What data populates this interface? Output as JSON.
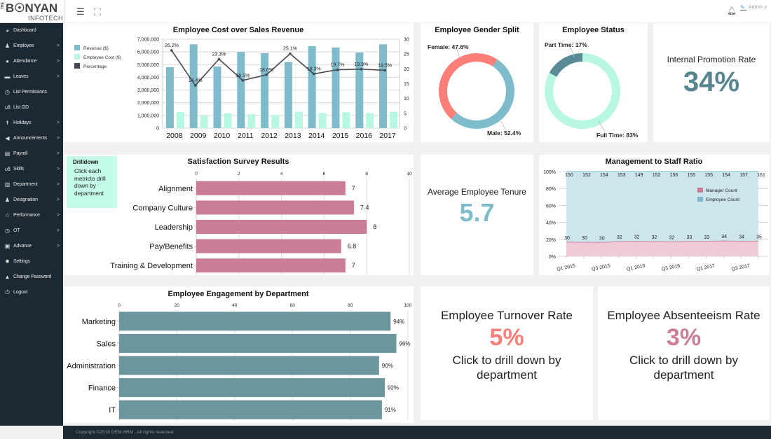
{
  "header": {
    "logo_prefix": "THE",
    "logo_main": "B☉NYAN",
    "logo_sub": "INFOTECH",
    "menu_icon": "hamburger-icon",
    "fullscreen_icon": "expand-icon",
    "notification_icon": "bell-icon",
    "user_label": "Admin",
    "user_caret": "∨"
  },
  "sidebar": {
    "items": [
      {
        "label": "Dashboard",
        "icon": "dashboard-icon",
        "glyph": "◕",
        "has_children": false
      },
      {
        "label": "Employee",
        "icon": "employee-icon",
        "glyph": "♟",
        "has_children": true
      },
      {
        "label": "Attendance",
        "icon": "attendance-icon",
        "glyph": "●",
        "has_children": true
      },
      {
        "label": "Leaves",
        "icon": "bed-icon",
        "glyph": "▬",
        "has_children": true
      },
      {
        "label": "List Permissions",
        "icon": "clock-icon",
        "glyph": "◷",
        "has_children": false
      },
      {
        "label": "List OD",
        "icon": "bicycle-icon",
        "glyph": "ൾ",
        "has_children": false
      },
      {
        "label": "Holidays",
        "icon": "person-icon",
        "glyph": "Ϯ",
        "has_children": true
      },
      {
        "label": "Announcements",
        "icon": "megaphone-icon",
        "glyph": "◀",
        "has_children": true
      },
      {
        "label": "Payroll",
        "icon": "calculator-icon",
        "glyph": "▤",
        "has_children": true
      },
      {
        "label": "Skills",
        "icon": "bicycle-icon",
        "glyph": "ൾ",
        "has_children": true
      },
      {
        "label": "Department",
        "icon": "building-icon",
        "glyph": "▥",
        "has_children": true
      },
      {
        "label": "Designation",
        "icon": "user-tie-icon",
        "glyph": "♟",
        "has_children": true
      },
      {
        "label": "Performance",
        "icon": "star-icon",
        "glyph": "☆",
        "has_children": true
      },
      {
        "label": "OT",
        "icon": "clock-icon",
        "glyph": "◷",
        "has_children": true
      },
      {
        "label": "Advance",
        "icon": "money-icon",
        "glyph": "▣",
        "has_children": true
      },
      {
        "label": "Settings",
        "icon": "gear-icon",
        "glyph": "✹",
        "has_children": false
      },
      {
        "label": "Change Password",
        "icon": "lock-icon",
        "glyph": "▲",
        "has_children": false
      },
      {
        "label": "Logout",
        "icon": "power-icon",
        "glyph": "⏻",
        "has_children": false
      }
    ],
    "chevron": ">"
  },
  "footer": {
    "copyright": "Copyright ©2019 GEM HRM , All rights reserved."
  },
  "colors": {
    "revenue": "#7fbccb",
    "employee_cost": "#b8f8e2",
    "percentage": "#444b52",
    "female": "#fb7e79",
    "male": "#7fbccb",
    "part_time": "#5a8a94",
    "full_time": "#b8f8e2",
    "satisfaction_bar": "#cb7d98",
    "engagement_bar": "#6b969d",
    "promotion_value": "#56848f",
    "tenure_value": "#7fbccb",
    "turnover_value": "#fb7e79",
    "absenteeism_value": "#cb7d98",
    "manager_area": "#f0cad6",
    "employee_area": "#cde6ec",
    "sidebar_bg": "#1d2932",
    "drill_bg": "#c4fbea"
  },
  "drilldown": {
    "title": "Drilldown",
    "text": "Click each metricto drill down by department"
  },
  "kpis": {
    "promotion": {
      "label": "Internal Promotion Rate",
      "value": "34%"
    },
    "tenure": {
      "label": "Average Employee Tenure",
      "value": "5.7"
    },
    "turnover": {
      "label": "Employee Turnover Rate",
      "value": "5%",
      "note": "Click to drill down by department"
    },
    "absenteeism": {
      "label": "Employee Absenteeism Rate",
      "value": "3%",
      "note": "Click to drill down by department"
    }
  },
  "chart_data": [
    {
      "id": "cost_revenue",
      "type": "bar",
      "title": "Employee Cost over Sales Revenue",
      "categories": [
        "2008",
        "2009",
        "2010",
        "2011",
        "2012",
        "2013",
        "2014",
        "2015",
        "2016",
        "2017"
      ],
      "series": [
        {
          "name": "Revenue ($)",
          "type": "bar",
          "axis": "left",
          "values": [
            4800000,
            6600000,
            4850000,
            6000000,
            5900000,
            5200000,
            6450000,
            6350000,
            5950000,
            6600000
          ]
        },
        {
          "name": "Employee Cost ($)",
          "type": "bar",
          "axis": "left",
          "values": [
            1270000,
            990000,
            1160000,
            1100000,
            1050000,
            1300000,
            1180000,
            1250000,
            1180000,
            1290000
          ]
        },
        {
          "name": "Percentage",
          "type": "line",
          "axis": "right",
          "values": [
            26.2,
            14.4,
            23.3,
            16.1,
            18.0,
            25.1,
            18.3,
            19.7,
            19.9,
            19.5
          ],
          "labels": [
            "26.2%",
            "14.4%",
            "23.3%",
            "16.1%",
            "18.0%",
            "25.1%",
            "18.3%",
            "19.7%",
            "19.9%",
            "19.5%"
          ]
        }
      ],
      "ylim_left": [
        0,
        7000000
      ],
      "yticks_left": [
        "0",
        "1,000,000",
        "2,000,000",
        "3,000,000",
        "4,000,000",
        "5,000,000",
        "6,000,000",
        "7,000,000"
      ],
      "ylim_right": [
        0,
        30
      ],
      "yticks_right": [
        "0",
        "5",
        "10",
        "15",
        "20",
        "25",
        "30"
      ],
      "legend": "left",
      "grid": true
    },
    {
      "id": "gender",
      "type": "pie",
      "title": "Employee Gender Split",
      "donut": true,
      "slices": [
        {
          "label": "Female",
          "value": 47.6,
          "text": "Female: 47.6%"
        },
        {
          "label": "Male",
          "value": 52.4,
          "text": "Male: 52.4%"
        }
      ]
    },
    {
      "id": "status",
      "type": "pie",
      "title": "Employee Status",
      "donut": true,
      "slices": [
        {
          "label": "Part Time",
          "value": 17,
          "text": "Part Time: 17%"
        },
        {
          "label": "Full Time",
          "value": 83,
          "text": "Full Time: 83%"
        }
      ]
    },
    {
      "id": "satisfaction",
      "type": "bar",
      "orientation": "horizontal",
      "title": "Satisfaction Survey Results",
      "categories": [
        "Alignment",
        "Company Culture",
        "Leadership",
        "Pay/Benefits",
        "Training & Development"
      ],
      "values": [
        7,
        7.4,
        8,
        6.8,
        7
      ],
      "labels": [
        "7",
        "7.4",
        "8",
        "6.8",
        "7"
      ],
      "xlim": [
        0,
        10
      ],
      "xticks": [
        "0",
        "2",
        "4",
        "6",
        "8",
        "10"
      ],
      "grid": true
    },
    {
      "id": "ratio",
      "type": "area",
      "stacked": "percent",
      "title": "Management to Staff Ratio",
      "x": [
        "Q1 2015",
        "Q2 2015",
        "Q3 2015",
        "Q4 2015",
        "Q1 2016",
        "Q2 2016",
        "Q3 2016",
        "Q4 2016",
        "Q1 2017",
        "Q2 2017",
        "Q3 2017",
        "Q4 2017"
      ],
      "xticks": [
        "Q1 2015",
        "Q3 2015",
        "Q1 2016",
        "Q3 2016",
        "Q1 2017",
        "Q3 2017"
      ],
      "series": [
        {
          "name": "Manager Count",
          "values": [
            30,
            30,
            30,
            32,
            32,
            32,
            32,
            33,
            33,
            34,
            34,
            35
          ]
        },
        {
          "name": "Employee Count",
          "values": [
            150,
            152,
            154,
            153,
            149,
            152,
            156,
            155,
            155,
            154,
            157,
            161
          ]
        }
      ],
      "yticks": [
        "0%",
        "20%",
        "40%",
        "60%",
        "80%",
        "100%"
      ],
      "legend": "top-right",
      "grid": true
    },
    {
      "id": "engagement",
      "type": "bar",
      "orientation": "horizontal",
      "title": "Employee Engagement by Department",
      "categories": [
        "Marketing",
        "Sales",
        "Administration",
        "Finance",
        "IT"
      ],
      "values": [
        94,
        96,
        90,
        92,
        91
      ],
      "labels": [
        "94%",
        "96%",
        "90%",
        "92%",
        "91%"
      ],
      "xlim": [
        0,
        100
      ],
      "xticks": [
        "0",
        "20",
        "40",
        "60",
        "80",
        "100"
      ],
      "grid": true
    }
  ]
}
